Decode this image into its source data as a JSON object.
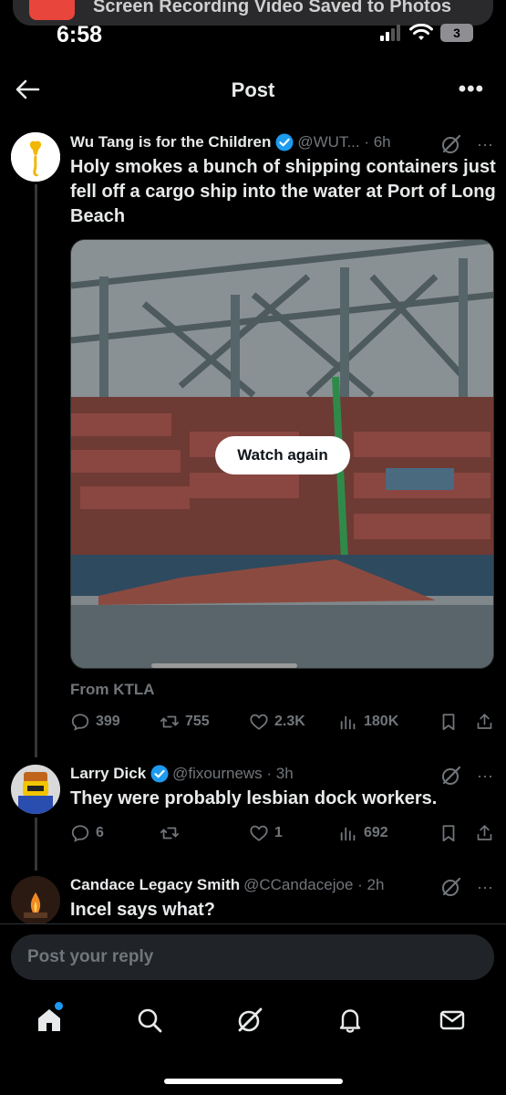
{
  "status_bar": {
    "time": "6:58",
    "battery": "3",
    "notification": "Screen Recording Video Saved to Photos"
  },
  "header": {
    "title": "Post",
    "more": "•••"
  },
  "main_post": {
    "author": "Wu Tang is for the Children",
    "handle": "@WUT... · 6h",
    "text": "Holy smokes a bunch of shipping containers just fell off a cargo ship into the water at Port of Long Beach",
    "media_button": "Watch again",
    "source": "From KTLA",
    "stats": {
      "replies": "399",
      "reposts": "755",
      "likes": "2.3K",
      "views": "180K"
    }
  },
  "replies": [
    {
      "author": "Larry Dick",
      "handle": "@fixournews · 3h",
      "text": "They were probably lesbian dock workers.",
      "stats": {
        "replies": "6",
        "reposts": "",
        "likes": "1",
        "views": "692"
      }
    },
    {
      "author": "Candace Legacy Smith",
      "handle": "@CCandacejoe · 2h",
      "text": "Incel says what?"
    }
  ],
  "reply_bar": {
    "placeholder": "Post your reply"
  },
  "colors": {
    "background": "#000000",
    "text": "#e7e9ea",
    "muted": "#71767b",
    "verified": "#1d9bf0",
    "accent_dot": "#1d9bf0"
  },
  "icons": [
    "back-arrow-icon",
    "more-icon",
    "verified-icon",
    "grok-icon",
    "reply-icon",
    "repost-icon",
    "like-icon",
    "views-icon",
    "bookmark-icon",
    "share-icon",
    "home-icon",
    "search-icon",
    "grok-tab-icon",
    "notifications-icon",
    "messages-icon"
  ]
}
